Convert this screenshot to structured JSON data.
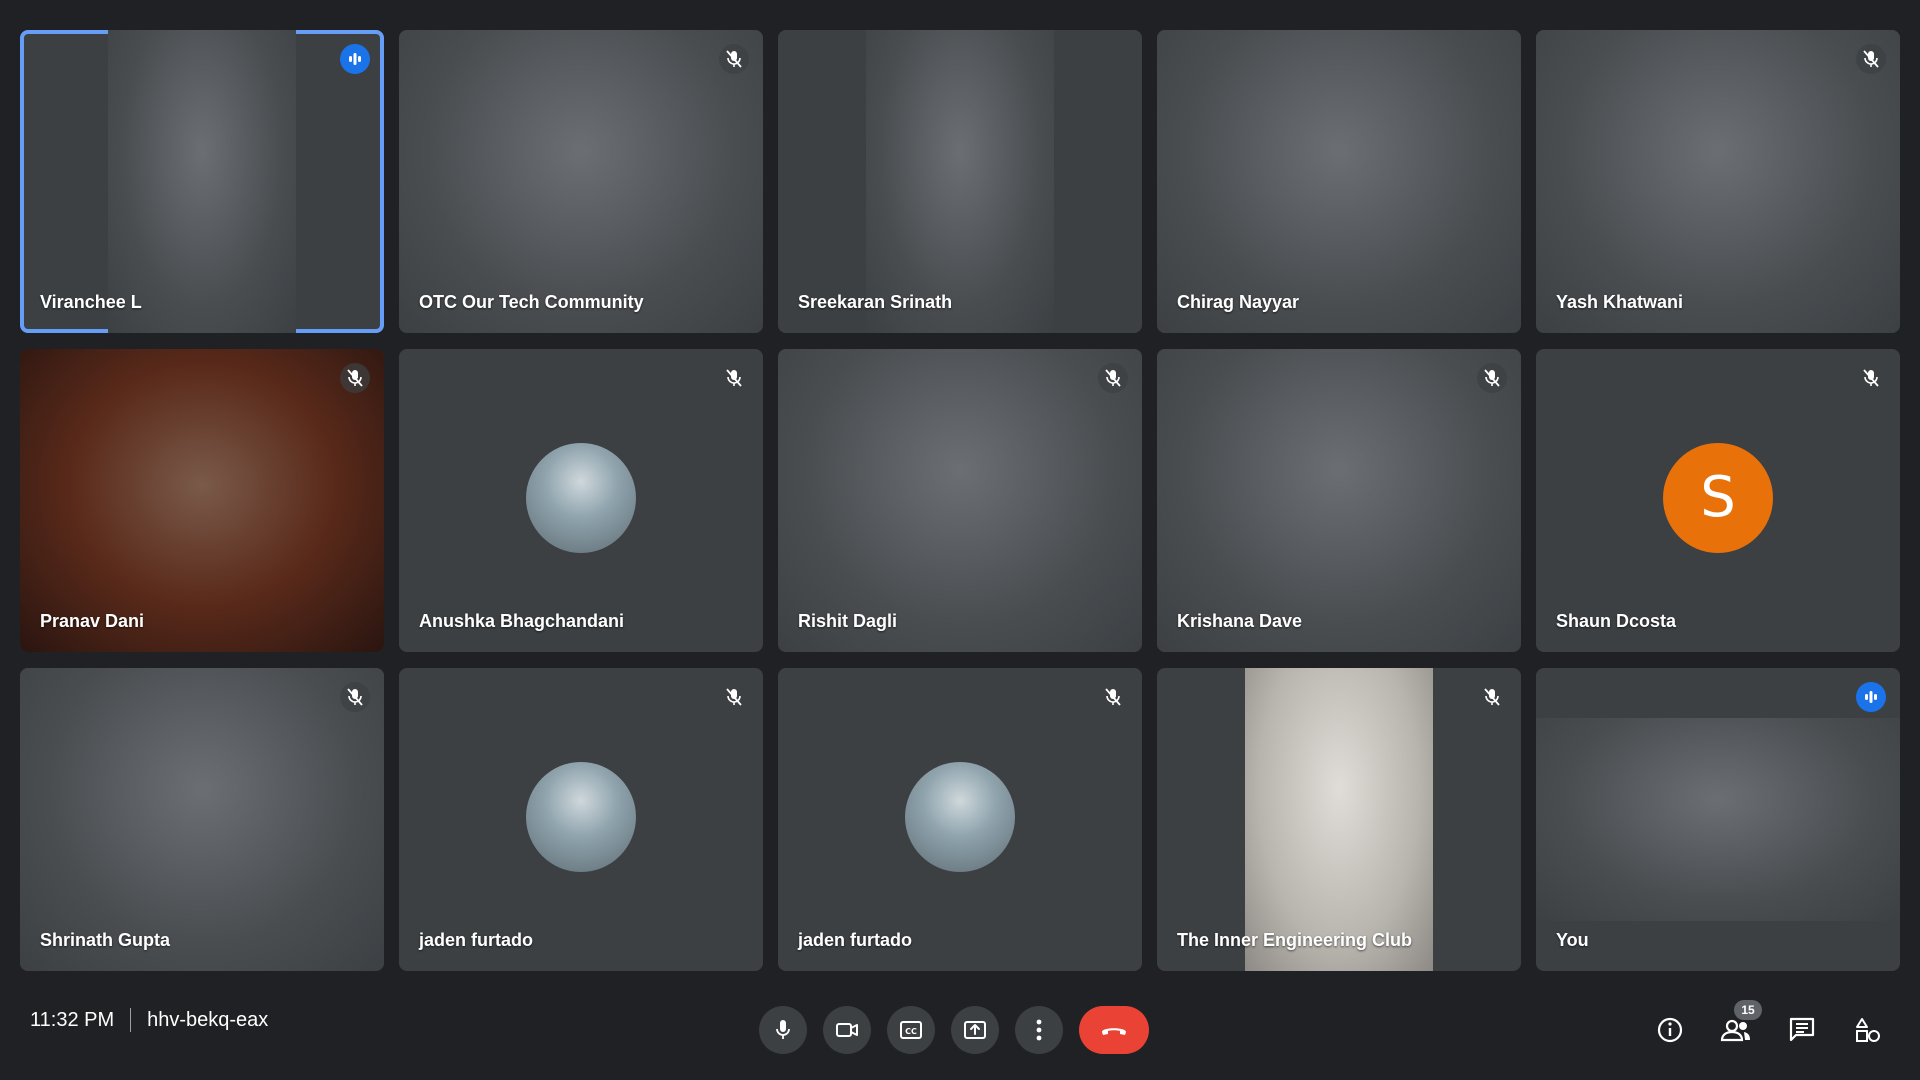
{
  "participants": [
    {
      "name": "Viranchee L",
      "status": "speaking",
      "active": true
    },
    {
      "name": "OTC Our Tech Community",
      "status": "muted"
    },
    {
      "name": "Sreekaran Srinath",
      "status": "none"
    },
    {
      "name": "Chirag Nayyar",
      "status": "none"
    },
    {
      "name": "Yash Khatwani",
      "status": "muted"
    },
    {
      "name": "Pranav Dani",
      "status": "muted"
    },
    {
      "name": "Anushka Bhagchandani",
      "status": "muted"
    },
    {
      "name": "Rishit Dagli",
      "status": "muted"
    },
    {
      "name": "Krishana Dave",
      "status": "muted"
    },
    {
      "name": "Shaun Dcosta",
      "status": "muted",
      "avatar_letter": "S"
    },
    {
      "name": "Shrinath Gupta",
      "status": "muted"
    },
    {
      "name": "jaden furtado",
      "status": "muted"
    },
    {
      "name": "jaden furtado",
      "status": "muted"
    },
    {
      "name": "The Inner Engineering Club",
      "status": "muted"
    },
    {
      "name": "You",
      "status": "speaking"
    }
  ],
  "meeting": {
    "time": "11:32 PM",
    "code": "hhv-bekq-eax"
  },
  "toolbar": {
    "participant_count": "15"
  },
  "colors": {
    "background": "#202124",
    "tile": "#3c4043",
    "active_border": "#669df6",
    "speaking_badge": "#1a73e8",
    "end_call": "#ea4335",
    "avatar_orange": "#e8710a"
  }
}
